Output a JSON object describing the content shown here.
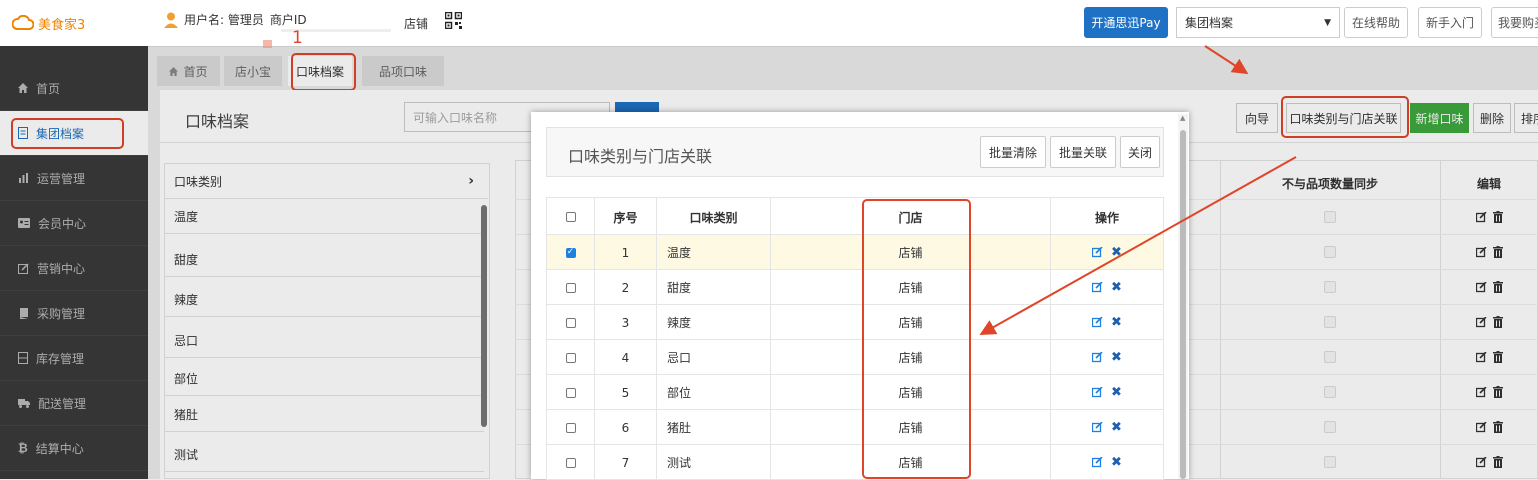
{
  "app": {
    "name": "美食家3",
    "brand_color": "#f08300",
    "annotation_number": "1"
  },
  "header": {
    "user_label": "用户名: 管理员",
    "merchant_label": "商户ID",
    "store_label": "店铺",
    "pay_button": "开通思迅Pay",
    "select_value": "集团档案",
    "help_button": "在线帮助",
    "newbie_button": "新手入门",
    "buy_button": "我要购买"
  },
  "sidebar": {
    "items": [
      {
        "label": "首页",
        "icon": "home-icon"
      },
      {
        "label": "集团档案",
        "icon": "document-icon"
      },
      {
        "label": "运营管理",
        "icon": "bar-chart-icon"
      },
      {
        "label": "会员中心",
        "icon": "member-card-icon"
      },
      {
        "label": "营销中心",
        "icon": "edit-icon"
      },
      {
        "label": "采购管理",
        "icon": "book-icon"
      },
      {
        "label": "库存管理",
        "icon": "storage-icon"
      },
      {
        "label": "配送管理",
        "icon": "truck-icon"
      },
      {
        "label": "结算中心",
        "icon": "currency-icon"
      }
    ]
  },
  "tabs": [
    {
      "label": "首页",
      "icon": "home-icon"
    },
    {
      "label": "店小宝"
    },
    {
      "label": "口味档案"
    },
    {
      "label": "品项口味"
    }
  ],
  "page": {
    "title": "口味档案",
    "search_placeholder": "可输入口味名称",
    "toolbar": {
      "guide": "向导",
      "associate": "口味类别与门店关联",
      "add": "新增口味",
      "delete": "删除",
      "sort": "排序"
    }
  },
  "category_list": {
    "header": "口味类别",
    "items": [
      "温度",
      "甜度",
      "辣度",
      "忌口",
      "部位",
      "猪肚",
      "测试"
    ]
  },
  "right_table": {
    "headers": [
      "不与品项数量同步",
      "编辑"
    ]
  },
  "modal": {
    "title": "口味类别与门店关联",
    "buttons": {
      "clear": "批量清除",
      "associate": "批量关联",
      "close": "关闭"
    },
    "columns": {
      "seq": "序号",
      "category": "口味类别",
      "store": "门店",
      "action": "操作"
    },
    "rows": [
      {
        "seq": "1",
        "category": "温度",
        "store": "店铺",
        "checked": true
      },
      {
        "seq": "2",
        "category": "甜度",
        "store": "店铺",
        "checked": false
      },
      {
        "seq": "3",
        "category": "辣度",
        "store": "店铺",
        "checked": false
      },
      {
        "seq": "4",
        "category": "忌口",
        "store": "店铺",
        "checked": false
      },
      {
        "seq": "5",
        "category": "部位",
        "store": "店铺",
        "checked": false
      },
      {
        "seq": "6",
        "category": "猪肚",
        "store": "店铺",
        "checked": false
      },
      {
        "seq": "7",
        "category": "测试",
        "store": "店铺",
        "checked": false
      }
    ]
  },
  "colors": {
    "primary": "#1e71c4",
    "annotation_red": "#e0452a",
    "green": "#3ea83e",
    "selected_row": "#fdf9e3"
  }
}
